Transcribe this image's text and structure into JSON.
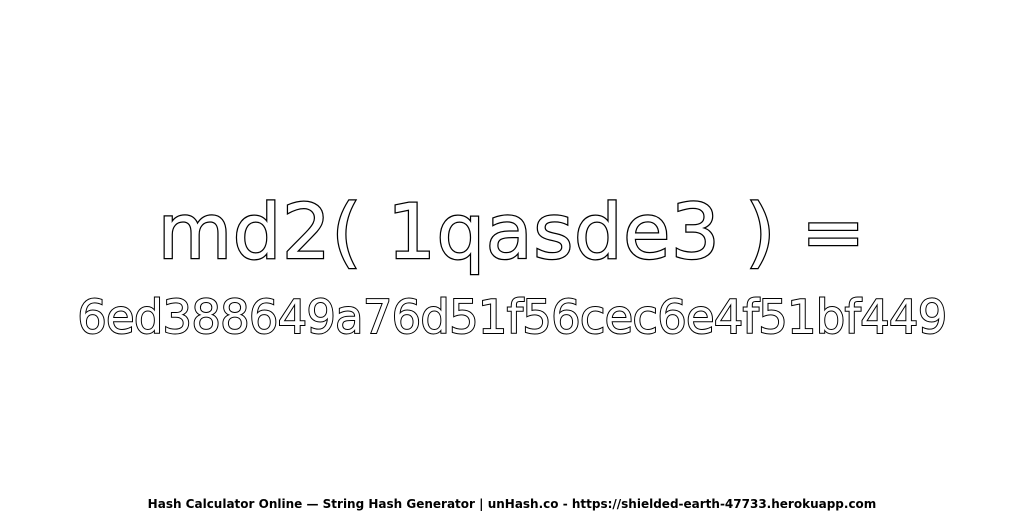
{
  "headline": {
    "expression": "md2( 1qasde3 ) =",
    "hash": "6ed388649a76d51f56cec6e4f51bf449"
  },
  "footer": {
    "text": "Hash Calculator Online — String Hash Generator | unHash.co - https://shielded-earth-47733.herokuapp.com"
  },
  "colors": {
    "background": "#ffffff",
    "text_fill": "#ffffff",
    "text_outline": "#000000"
  }
}
